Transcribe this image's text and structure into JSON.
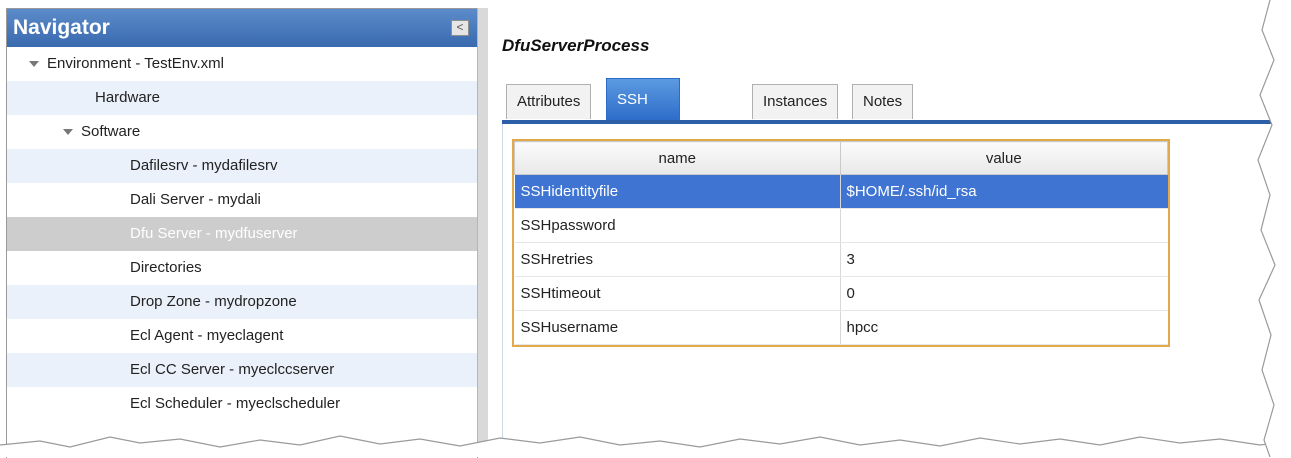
{
  "navigator": {
    "title": "Navigator",
    "collapse_glyph": "<",
    "tree": [
      {
        "label": "Environment - TestEnv.xml",
        "level": 0,
        "expanded": true
      },
      {
        "label": "Hardware",
        "level": 1
      },
      {
        "label": "Software",
        "level": "1a",
        "expanded": true
      },
      {
        "label": "Dafilesrv - mydafilesrv",
        "level": 2
      },
      {
        "label": "Dali Server - mydali",
        "level": 2
      },
      {
        "label": "Dfu Server - mydfuserver",
        "level": 2,
        "selected": true
      },
      {
        "label": "Directories",
        "level": 2
      },
      {
        "label": "Drop Zone - mydropzone",
        "level": 2
      },
      {
        "label": "Ecl Agent - myeclagent",
        "level": 2
      },
      {
        "label": "Ecl CC Server - myeclccserver",
        "level": 2
      },
      {
        "label": "Ecl Scheduler - myeclscheduler",
        "level": 2
      }
    ]
  },
  "detail": {
    "title": "DfuServerProcess",
    "tabs": [
      {
        "label": "Attributes"
      },
      {
        "label": "SSH Options",
        "active": true
      },
      {
        "label": "Instances"
      },
      {
        "label": "Notes"
      }
    ],
    "grid": {
      "columns": [
        "name",
        "value"
      ],
      "rows": [
        {
          "name": "SSHidentityfile",
          "value": "$HOME/.ssh/id_rsa",
          "selected": true
        },
        {
          "name": "SSHpassword",
          "value": ""
        },
        {
          "name": "SSHretries",
          "value": "3"
        },
        {
          "name": "SSHtimeout",
          "value": "0"
        },
        {
          "name": "SSHusername",
          "value": "hpcc"
        }
      ]
    }
  },
  "colors": {
    "accent": "#3f74d2",
    "header": "#3a6aaf",
    "grid_border": "#e2a94a"
  }
}
